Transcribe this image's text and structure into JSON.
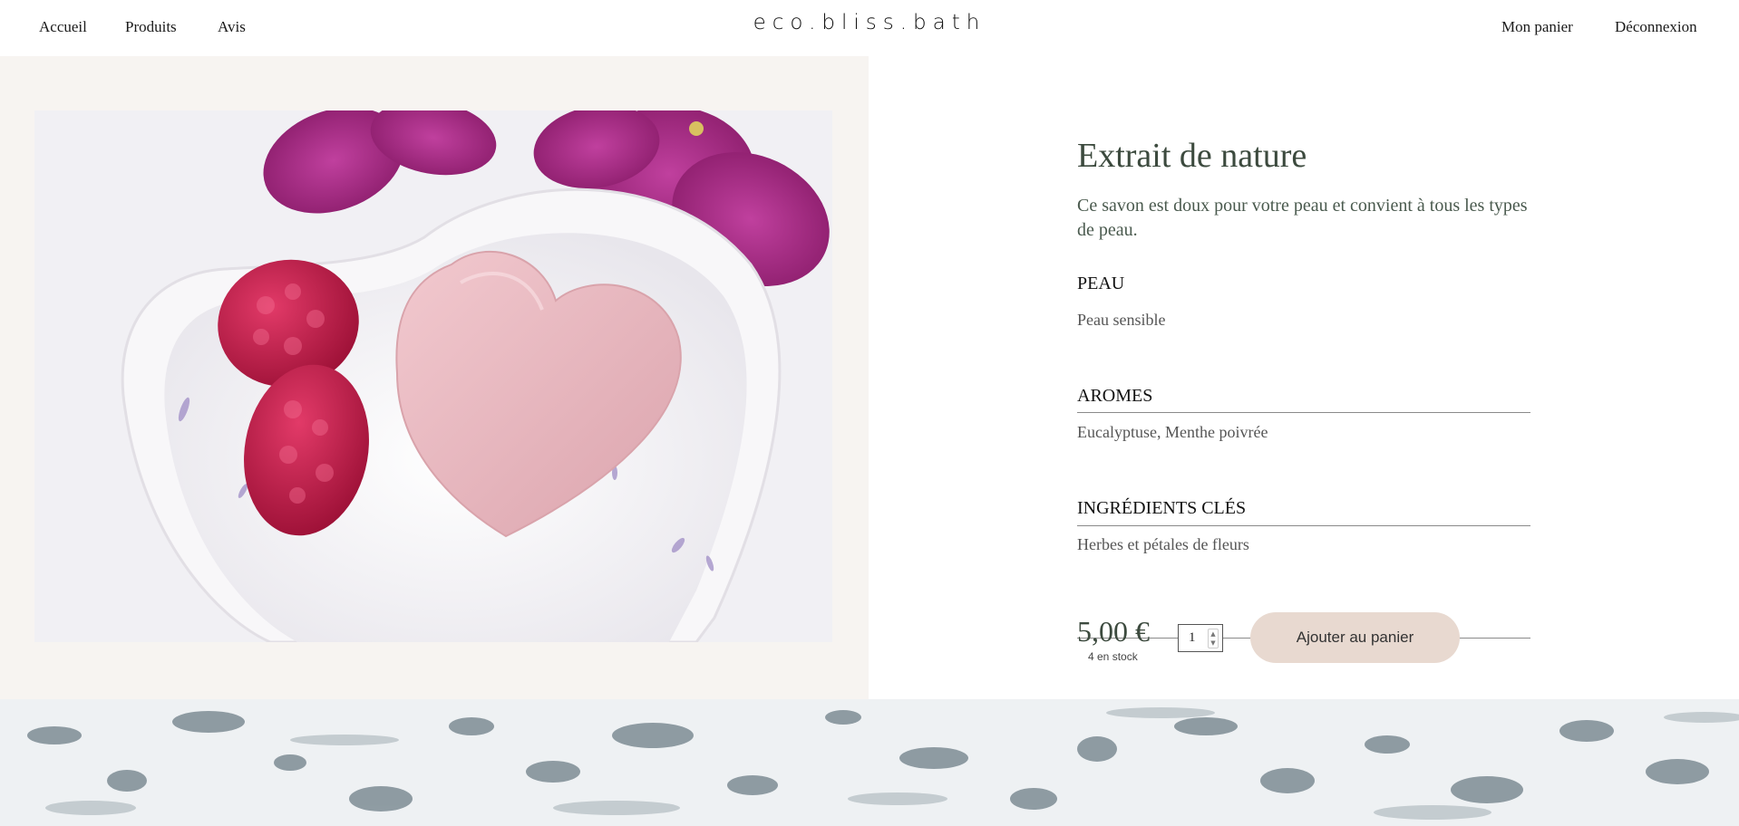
{
  "header": {
    "nav_left": [
      "Accueil",
      "Produits",
      "Avis"
    ],
    "logo": "eco.bliss.bath",
    "nav_right": [
      "Mon panier",
      "Déconnexion"
    ]
  },
  "product": {
    "image_icon": "soap-heart-image",
    "title": "Extrait de nature",
    "description": "Ce savon est doux pour votre peau et convient à tous les types de peau.",
    "sections": [
      {
        "title": "PEAU",
        "value": "Peau sensible"
      },
      {
        "title": "AROMES",
        "value": "Eucalyptuse, Menthe poivrée"
      },
      {
        "title": "INGRÉDIENTS CLÉS",
        "value": "Herbes et pétales de fleurs"
      }
    ],
    "price": "5,00 €",
    "stock": "4 en stock",
    "quantity": "1",
    "add_to_cart_label": "Ajouter au panier"
  },
  "colors": {
    "accent_button": "#e8d9d0",
    "title_green": "#3c4a3e",
    "panel_beige": "#f7f4f1"
  }
}
